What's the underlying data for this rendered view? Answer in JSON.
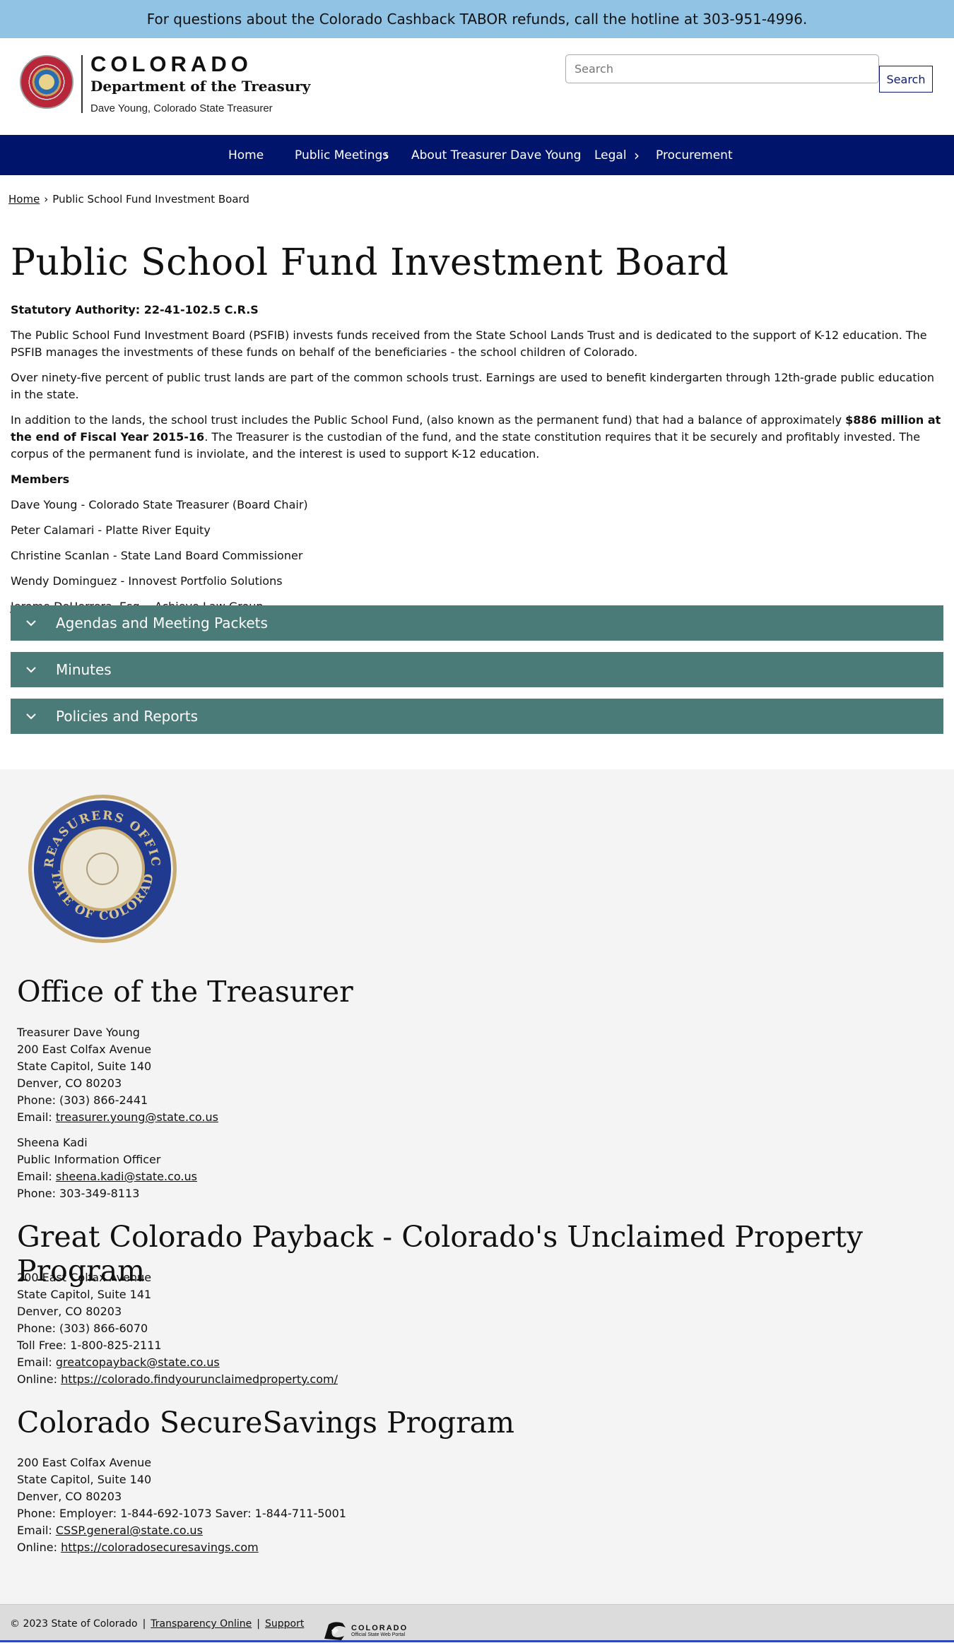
{
  "alert": {
    "text": "For questions about the Colorado Cashback TABOR refunds, call the hotline at 303-951-4996."
  },
  "header": {
    "logo_title": "COLORADO",
    "logo_dept": "Department of the Treasury",
    "logo_sub": "Dave Young, Colorado State Treasurer",
    "search_placeholder": "Search",
    "search_button": "Search"
  },
  "nav": {
    "items": [
      {
        "label": "Home"
      },
      {
        "label": "Public Meetings"
      },
      {
        "label": "About Treasurer Dave Young"
      },
      {
        "label": "Legal"
      },
      {
        "label": "Procurement"
      }
    ]
  },
  "breadcrumb": {
    "home": "Home",
    "separator": "›",
    "current": "Public School Fund Investment Board"
  },
  "main": {
    "title": "Public School Fund Investment Board",
    "statutory": "Statutory Authority: 22-41-102.5 C.R.S",
    "p1": "The Public School Fund Investment Board (PSFIB) invests funds received from the State School Lands Trust and is dedicated to the support of K-12 education. The PSFIB manages the investments of these funds on behalf of the beneficiaries - the school children of Colorado.",
    "p2": "Over ninety-five percent of public trust lands are part of the common schools trust. Earnings are used to benefit kindergarten through 12th-grade public education in the state.",
    "p3_start": "In addition to the lands, the school trust includes the Public School Fund, (also known as the permanent fund) that had a balance of approximately ",
    "p3_bold": "$886 million at the end of Fiscal Year 2015-16",
    "p3_end": ". The Treasurer is the custodian of the fund, and the state constitution requires that it be securely and profitably invested. The corpus of the permanent fund is inviolate, and the interest is used to support K-12 education.",
    "members_heading": "Members",
    "members": [
      "Dave Young - Colorado State Treasurer (Board Chair)",
      "Peter Calamari - Platte River Equity",
      "Christine Scanlan - State Land Board Commissioner",
      "Wendy Dominguez - Innovest Portfolio Solutions",
      "Jerome DeHerrera, Esq. - Achieve Law Group"
    ],
    "accordions": [
      {
        "label": "Agendas and Meeting Packets"
      },
      {
        "label": "Minutes"
      },
      {
        "label": "Policies and Reports"
      }
    ]
  },
  "footer": {
    "seal_alt": "TREASURERS OFFICE · STATE OF COLORADO",
    "office": {
      "heading": "Office of the Treasurer",
      "lines": [
        "Treasurer Dave Young",
        "200 East Colfax Avenue",
        "State Capitol, Suite 140",
        "Denver, CO 80203",
        "Phone: (303) 866-2441"
      ],
      "email_label": "Email: ",
      "email": "treasurer.young@state.co.us",
      "pio_lines": [
        "Sheena Kadi",
        "Public Information Officer"
      ],
      "pio_email_label": "Email: ",
      "pio_email": "sheena.kadi@state.co.us",
      "pio_phone": "Phone: 303-349-8113"
    },
    "payback": {
      "heading": "Great Colorado Payback - Colorado's Unclaimed Property Program",
      "lines": [
        "200 East Colfax Avenue",
        "State Capitol, Suite 141",
        "Denver, CO 80203",
        "Phone: (303) 866-6070",
        "Toll Free:  1-800-825-2111"
      ],
      "email_label": "Email: ",
      "email": "greatcopayback@state.co.us",
      "online_label": "Online: ",
      "online": "https://colorado.findyourunclaimedproperty.com/"
    },
    "securesavings": {
      "heading": "Colorado SecureSavings Program",
      "lines": [
        "200 East Colfax Avenue",
        "State Capitol, Suite 140",
        "Denver, CO 80203",
        "Phone: Employer: 1-844-692-1073  Saver: 1-844-711-5001"
      ],
      "email_label": "Email: ",
      "email": "CSSP.general@state.co.us",
      "online_label": "Online: ",
      "online": "https://coloradosecuresavings.com"
    }
  },
  "bottom": {
    "copyright": "© 2023 State of Colorado",
    "pipe": "|",
    "transparency": "Transparency Online",
    "support": "Support",
    "portal_title": "COLORADO",
    "portal_sub": "Official State Web Portal"
  },
  "colors": {
    "alert_bg": "#91c3e4",
    "nav_bg": "#00146b",
    "accordion_bg": "#4b7b78",
    "footer_bg": "#f4f4f4"
  }
}
